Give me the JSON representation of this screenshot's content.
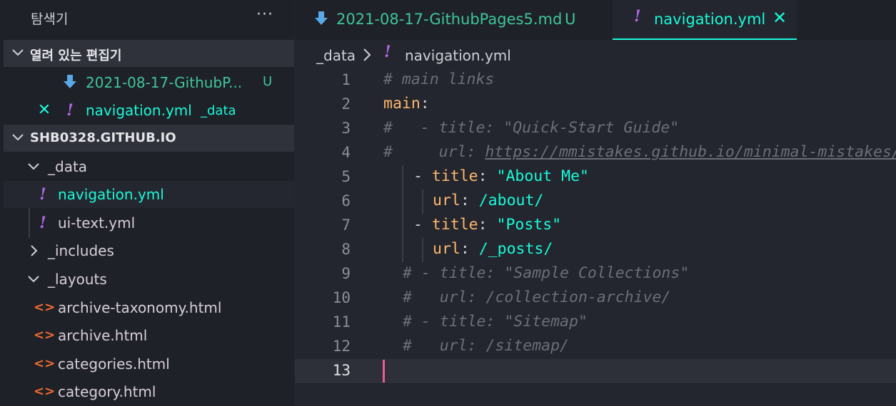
{
  "sidebar": {
    "title": "탐색기",
    "more_label": "···",
    "open_editors": {
      "label": "열려 있는 편집기",
      "items": [
        {
          "name": "2021-08-17-GithubP...",
          "status": "U",
          "icon": "download-arrow-icon"
        },
        {
          "name": "navigation.yml",
          "folder": "_data",
          "icon": "yaml-exclamation-icon"
        }
      ]
    },
    "workspace": {
      "label": "SHB0328.GITHUB.IO",
      "tree": [
        {
          "name": "_data",
          "type": "folder",
          "expanded": true
        },
        {
          "name": "navigation.yml",
          "type": "file",
          "icon": "yaml-exclamation-icon",
          "selected": true
        },
        {
          "name": "ui-text.yml",
          "type": "file",
          "icon": "yaml-exclamation-icon"
        },
        {
          "name": "_includes",
          "type": "folder",
          "expanded": false
        },
        {
          "name": "_layouts",
          "type": "folder",
          "expanded": true
        },
        {
          "name": "archive-taxonomy.html",
          "type": "file",
          "icon": "html-brackets-icon"
        },
        {
          "name": "archive.html",
          "type": "file",
          "icon": "html-brackets-icon"
        },
        {
          "name": "categories.html",
          "type": "file",
          "icon": "html-brackets-icon"
        },
        {
          "name": "category.html",
          "type": "file",
          "icon": "html-brackets-icon"
        }
      ]
    }
  },
  "tabs": [
    {
      "label": "2021-08-17-GithubPages5.md",
      "status": "U",
      "icon": "download-arrow-icon",
      "active": false
    },
    {
      "label": "navigation.yml",
      "icon": "yaml-exclamation-icon",
      "active": true,
      "close": "✕"
    }
  ],
  "breadcrumb": {
    "folder": "_data",
    "file": "navigation.yml"
  },
  "editor": {
    "current_line": 13,
    "lines": [
      {
        "n": "1",
        "comment": "# main links"
      },
      {
        "n": "2",
        "key": "main",
        "colon": ":"
      },
      {
        "n": "3",
        "comment": "#   - title: \"Quick-Start Guide\""
      },
      {
        "n": "4",
        "comment": "#     url: ",
        "link": "https://mmistakes.github.io/minimal-mistakes/docs/quick-start-guide/"
      },
      {
        "n": "5",
        "dash": "- ",
        "key": "title",
        "colon": ": ",
        "str": "\"About Me\""
      },
      {
        "n": "6",
        "key": "url",
        "colon": ": ",
        "val": "/about/"
      },
      {
        "n": "7",
        "dash": "- ",
        "key": "title",
        "colon": ": ",
        "str": "\"Posts\""
      },
      {
        "n": "8",
        "key": "url",
        "colon": ": ",
        "val": "/_posts/"
      },
      {
        "n": "9",
        "comment": "# - title: \"Sample Collections\""
      },
      {
        "n": "10",
        "comment": "#   url: /collection-archive/"
      },
      {
        "n": "11",
        "comment": "# - title: \"Sitemap\""
      },
      {
        "n": "12",
        "comment": "#   url: /sitemap/"
      },
      {
        "n": "13"
      }
    ]
  },
  "colors": {
    "accent": "#19f9d8",
    "untracked": "#3fc59b",
    "yaml_icon": "#b267e6",
    "html_icon": "#f06b2c",
    "yaml_key": "#ffb86c",
    "cursor": "#ef5b8c"
  }
}
